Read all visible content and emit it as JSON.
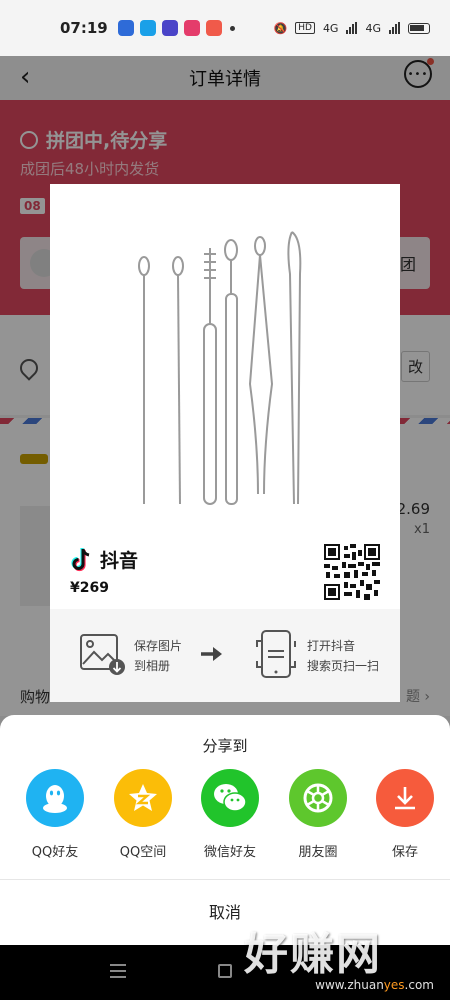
{
  "status_bar": {
    "time": "07:19",
    "network": "4G",
    "network2": "4G",
    "hd": "HD"
  },
  "header": {
    "title": "订单详情"
  },
  "order": {
    "status": "拼团中,待分享",
    "sub": "成团后48小时内发货",
    "countdown": "08",
    "invite_button": "团",
    "edit_button": "改",
    "price_partial": "2.69",
    "qty": "x1",
    "shopping_label": "购物",
    "question_link": "题 ›"
  },
  "card": {
    "brand_name": "抖音",
    "price": "¥269",
    "step1_line1": "保存图片",
    "step1_line2": "到相册",
    "step2_line1": "打开抖音",
    "step2_line2": "搜索页扫一扫"
  },
  "share_sheet": {
    "title": "分享到",
    "items": [
      {
        "label": "QQ好友",
        "icon": "qq-icon",
        "color": "#1fb3f2"
      },
      {
        "label": "QQ空间",
        "icon": "qzone-icon",
        "color": "#fbbd08"
      },
      {
        "label": "微信好友",
        "icon": "wechat-icon",
        "color": "#21c42b"
      },
      {
        "label": "朋友圈",
        "icon": "moments-icon",
        "color": "#5ec72d"
      },
      {
        "label": "保存",
        "icon": "save-icon",
        "color": "#f65b3c"
      }
    ],
    "cancel": "取消"
  },
  "watermark": {
    "big": "好赚网",
    "small_a": "www.zhuan",
    "small_yes": "yes",
    "small_b": ".com"
  }
}
